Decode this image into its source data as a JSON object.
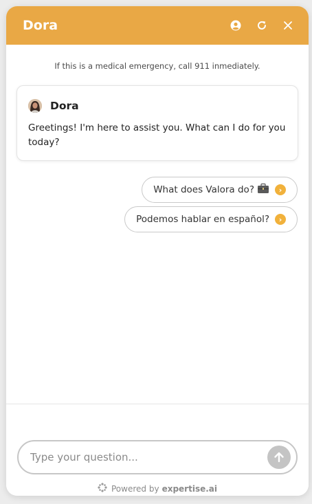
{
  "header": {
    "title": "Dora",
    "icons": [
      "account-icon",
      "refresh-icon",
      "close-icon"
    ],
    "background": "#e9a845"
  },
  "emergency_notice": "If this is a medical emergency, call 911 inmediately.",
  "message": {
    "sender": "Dora",
    "text": "Greetings! I'm here to assist you. What can I do for you today?"
  },
  "suggestions": [
    {
      "label": "What does Valora do?",
      "emoji": "briefcase-icon"
    },
    {
      "label": "Podemos hablar en español?"
    }
  ],
  "composer": {
    "placeholder": "Type your question...",
    "value": ""
  },
  "powered_by": {
    "prefix": "Powered by",
    "brand": "expertise.ai"
  },
  "colors": {
    "accent": "#e9a845",
    "arrow": "#f1b13b",
    "send_button": "#c4c4c4"
  }
}
